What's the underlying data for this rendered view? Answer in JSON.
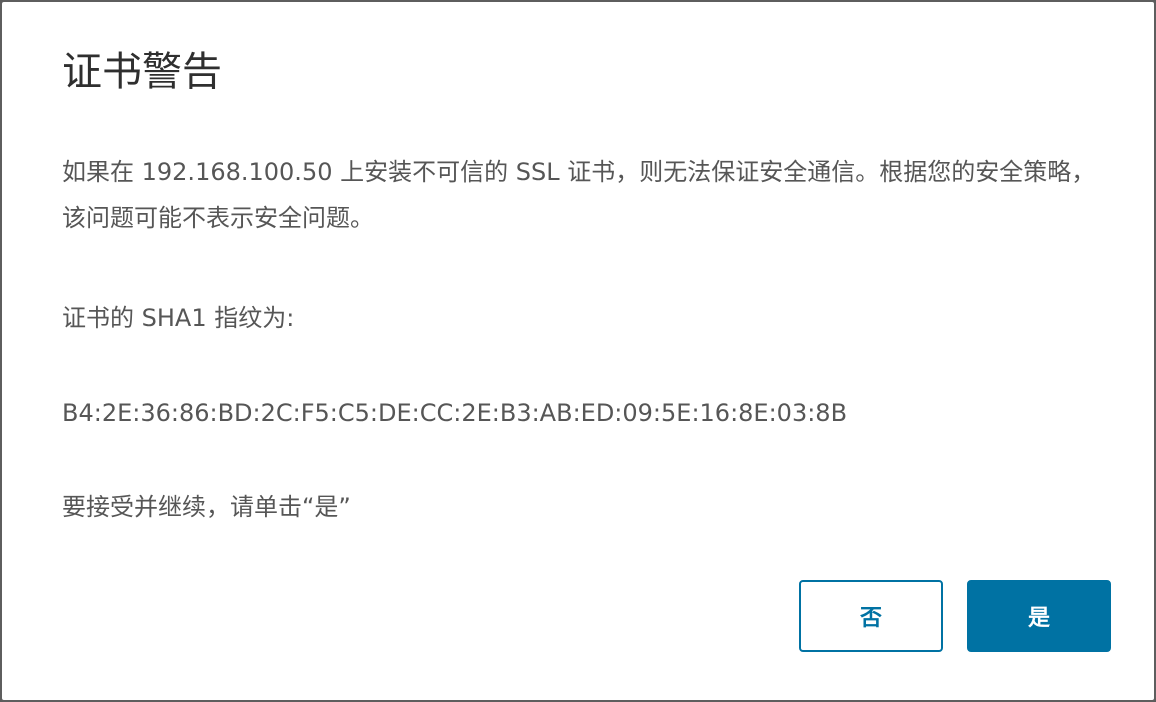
{
  "dialog": {
    "title": "证书警告",
    "warning": "如果在 192.168.100.50 上安装不可信的 SSL 证书，则无法保证安全通信。根据您的安全策略，该问题可能不表示安全问题。",
    "fingerprint_label": "证书的 SHA1 指纹为:",
    "fingerprint": "B4:2E:36:86:BD:2C:F5:C5:DE:CC:2E:B3:AB:ED:09:5E:16:8E:03:8B",
    "continue_hint": "要接受并继续，请单击“是”",
    "no_label": "否",
    "yes_label": "是"
  },
  "colors": {
    "accent": "#0072a3",
    "title_text": "#2f2f2f",
    "body_text": "#565656",
    "backdrop": "#5c5c5c"
  }
}
